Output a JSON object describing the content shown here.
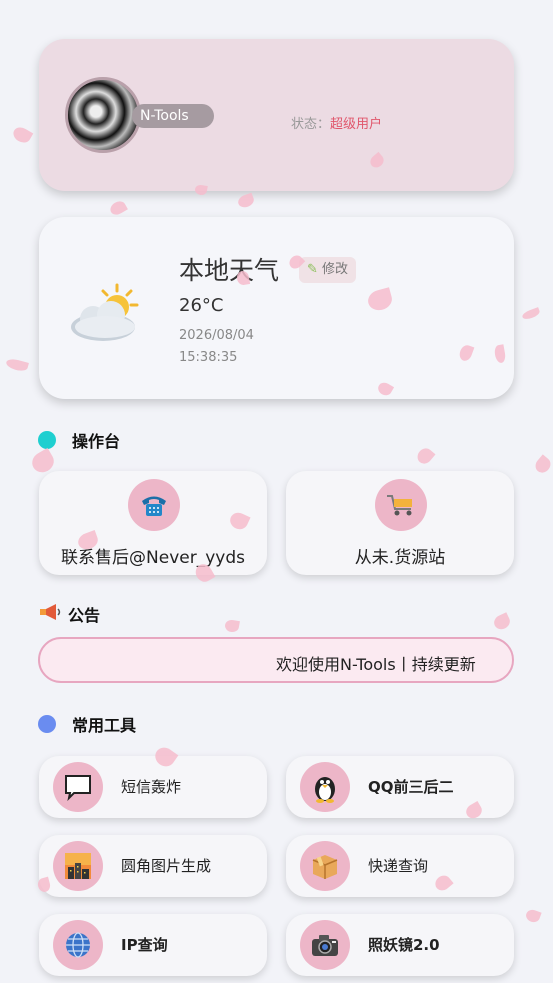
{
  "profile": {
    "name": "N-Tools",
    "status_label": "状态：",
    "status_value": "超级用户"
  },
  "weather": {
    "title": "本地天气",
    "edit_label": "修改",
    "temperature": "26°C",
    "date": "2026/08/04",
    "time": "15:38:35"
  },
  "console": {
    "title": "操作台",
    "dot_color": "#1fcfd0",
    "items": [
      {
        "label": "联系售后@Never_yyds",
        "icon": "telephone-icon"
      },
      {
        "label": "从未.货源站",
        "icon": "shopping-cart-icon"
      }
    ]
  },
  "notice": {
    "title": "公告",
    "icon": "megaphone-icon",
    "text": "欢迎使用N-Tools丨持续更新"
  },
  "tools": {
    "title": "常用工具",
    "dot_color": "#6a8cf0",
    "items": [
      {
        "label": "短信轰炸",
        "icon": "speech-bubble-icon"
      },
      {
        "label": "QQ前三后二",
        "icon": "penguin-icon"
      },
      {
        "label": "圆角图片生成",
        "icon": "city-sunset-icon"
      },
      {
        "label": "快递查询",
        "icon": "package-icon"
      },
      {
        "label": "IP查询",
        "icon": "globe-icon"
      },
      {
        "label": "照妖镜2.0",
        "icon": "camera-icon"
      }
    ]
  },
  "colors": {
    "accent_pink": "#edb6c8",
    "status_red": "#e0566b",
    "notice_border": "#e7a6c0"
  }
}
